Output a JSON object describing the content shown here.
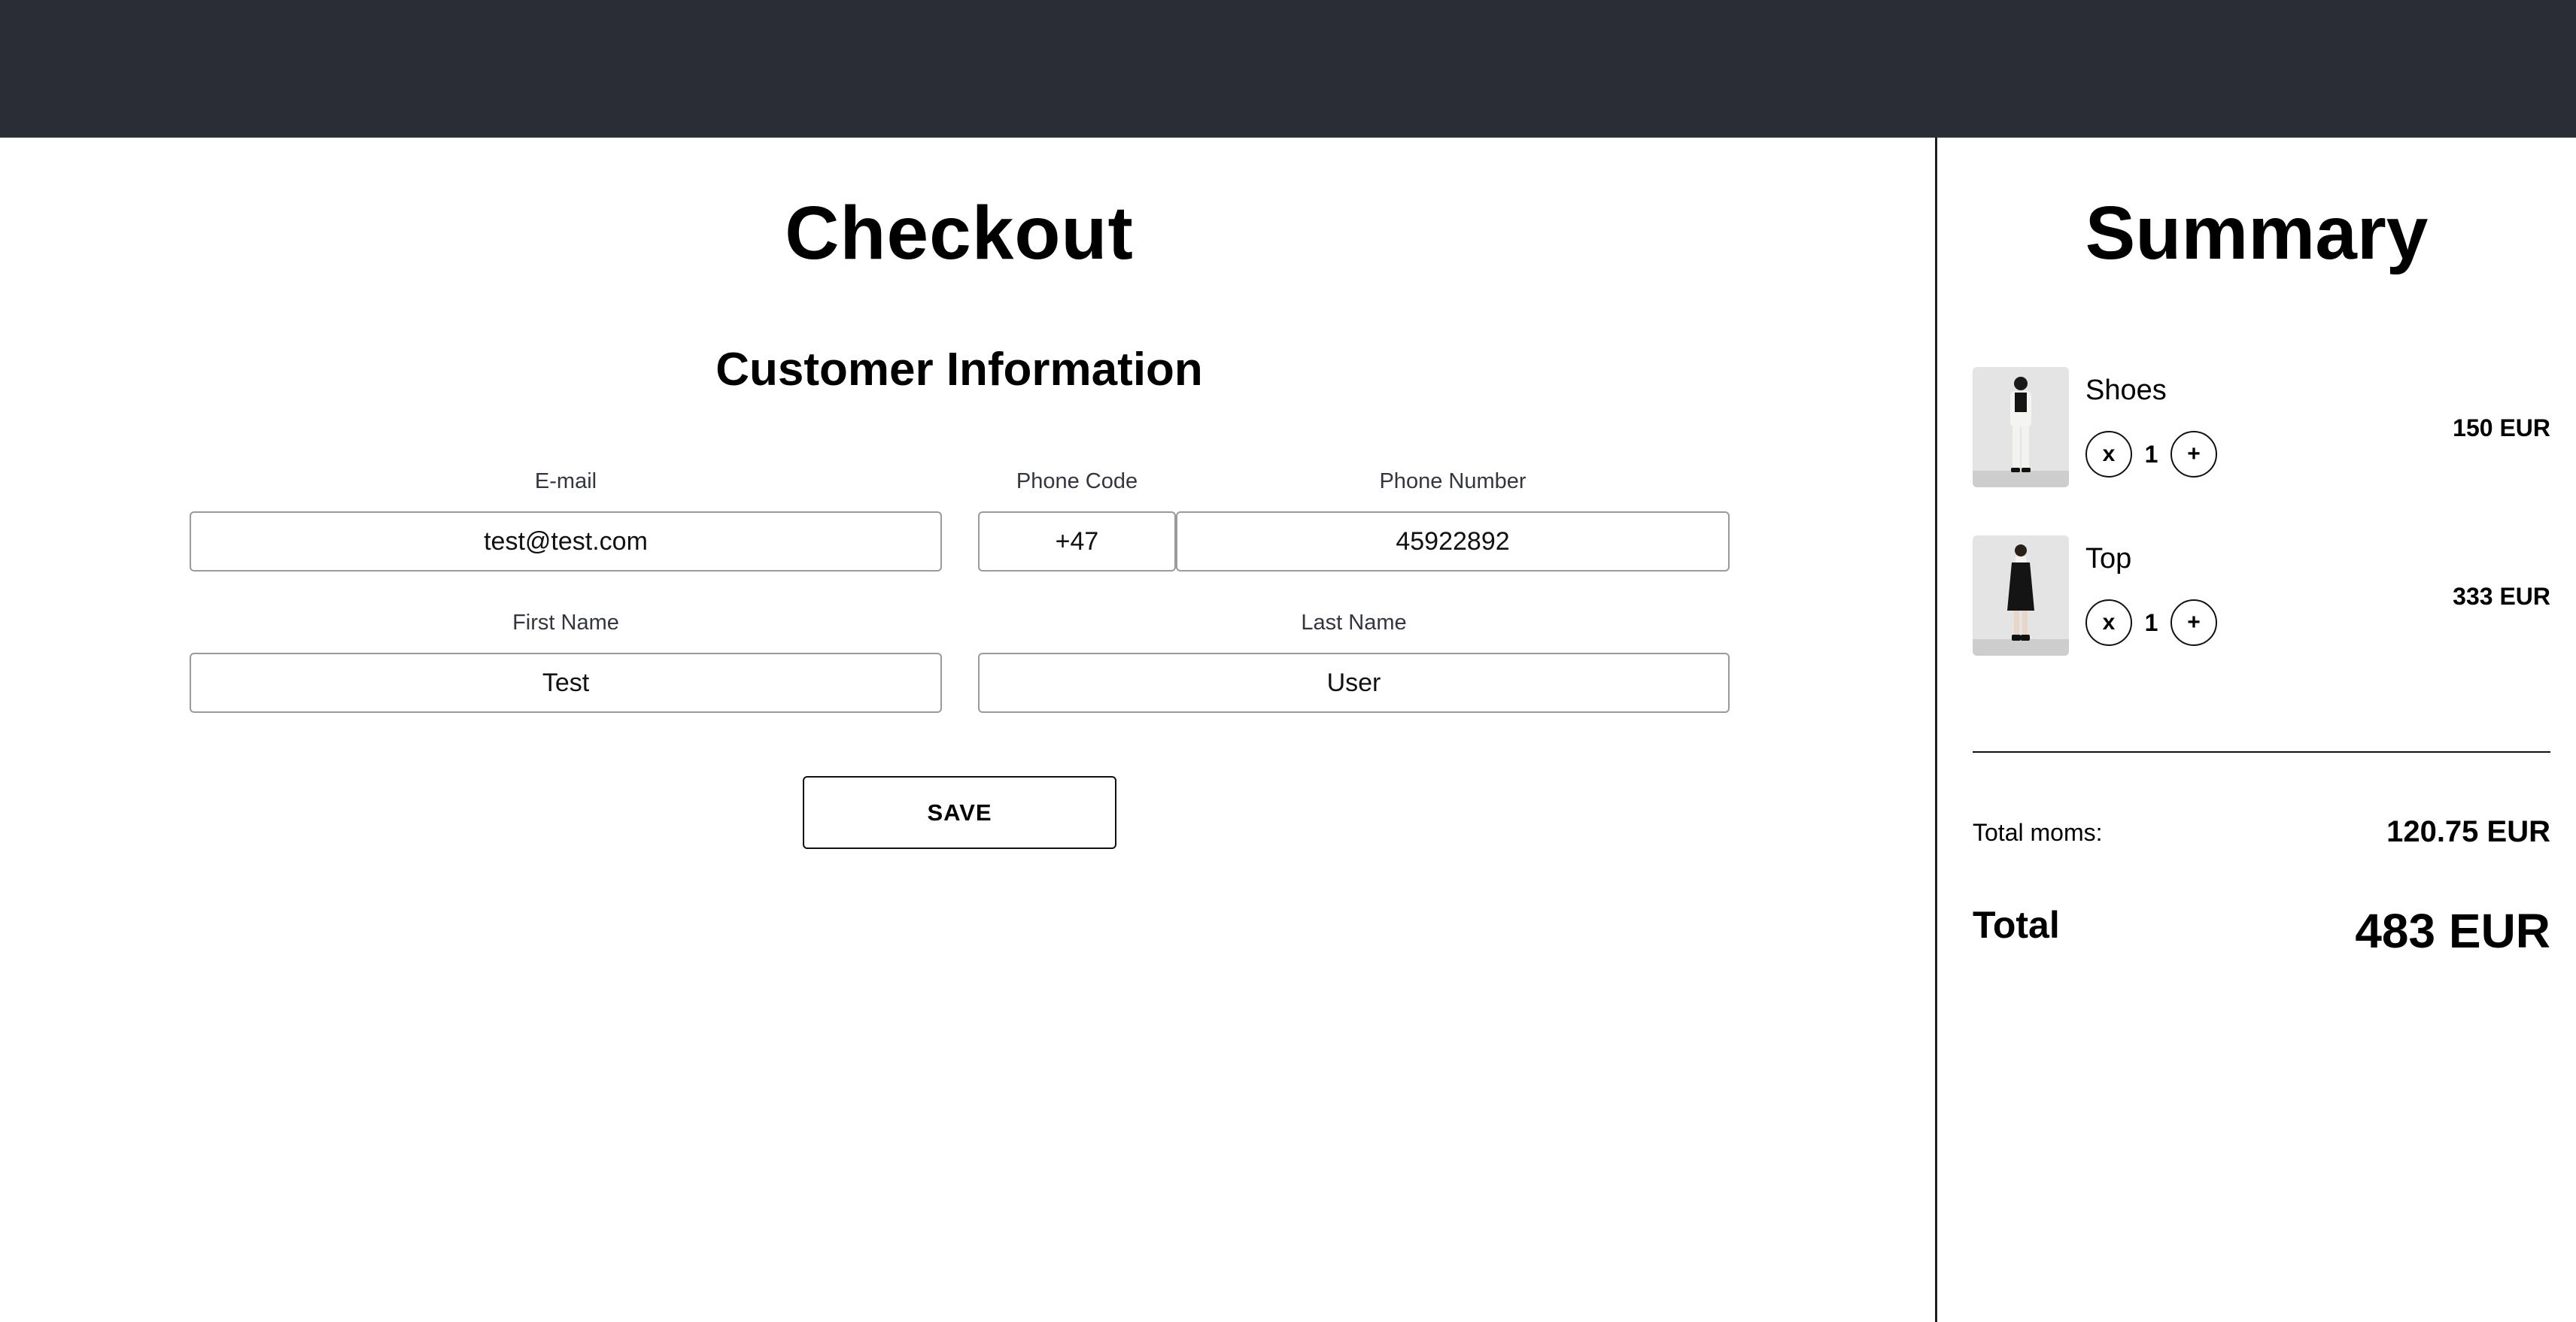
{
  "header": {
    "background_color": "#2a2d35"
  },
  "checkout": {
    "title": "Checkout",
    "section_title": "Customer Information",
    "fields": {
      "email": {
        "label": "E-mail",
        "value": "test@test.com"
      },
      "phone_code": {
        "label": "Phone Code",
        "value": "+47"
      },
      "phone_number": {
        "label": "Phone Number",
        "value": "45922892"
      },
      "first_name": {
        "label": "First Name",
        "value": "Test"
      },
      "last_name": {
        "label": "Last Name",
        "value": "User"
      }
    },
    "save_label": "SAVE"
  },
  "summary": {
    "title": "Summary",
    "items": [
      {
        "name": "Shoes",
        "quantity": "1",
        "remove_label": "x",
        "add_label": "+",
        "price": "150 EUR",
        "thumbnail": "product-photo-white-outfit"
      },
      {
        "name": "Top",
        "quantity": "1",
        "remove_label": "x",
        "add_label": "+",
        "price": "333 EUR",
        "thumbnail": "product-photo-black-dress"
      }
    ],
    "moms_label": "Total moms:",
    "moms_value": "120.75 EUR",
    "total_label": "Total",
    "total_value": "483 EUR"
  }
}
